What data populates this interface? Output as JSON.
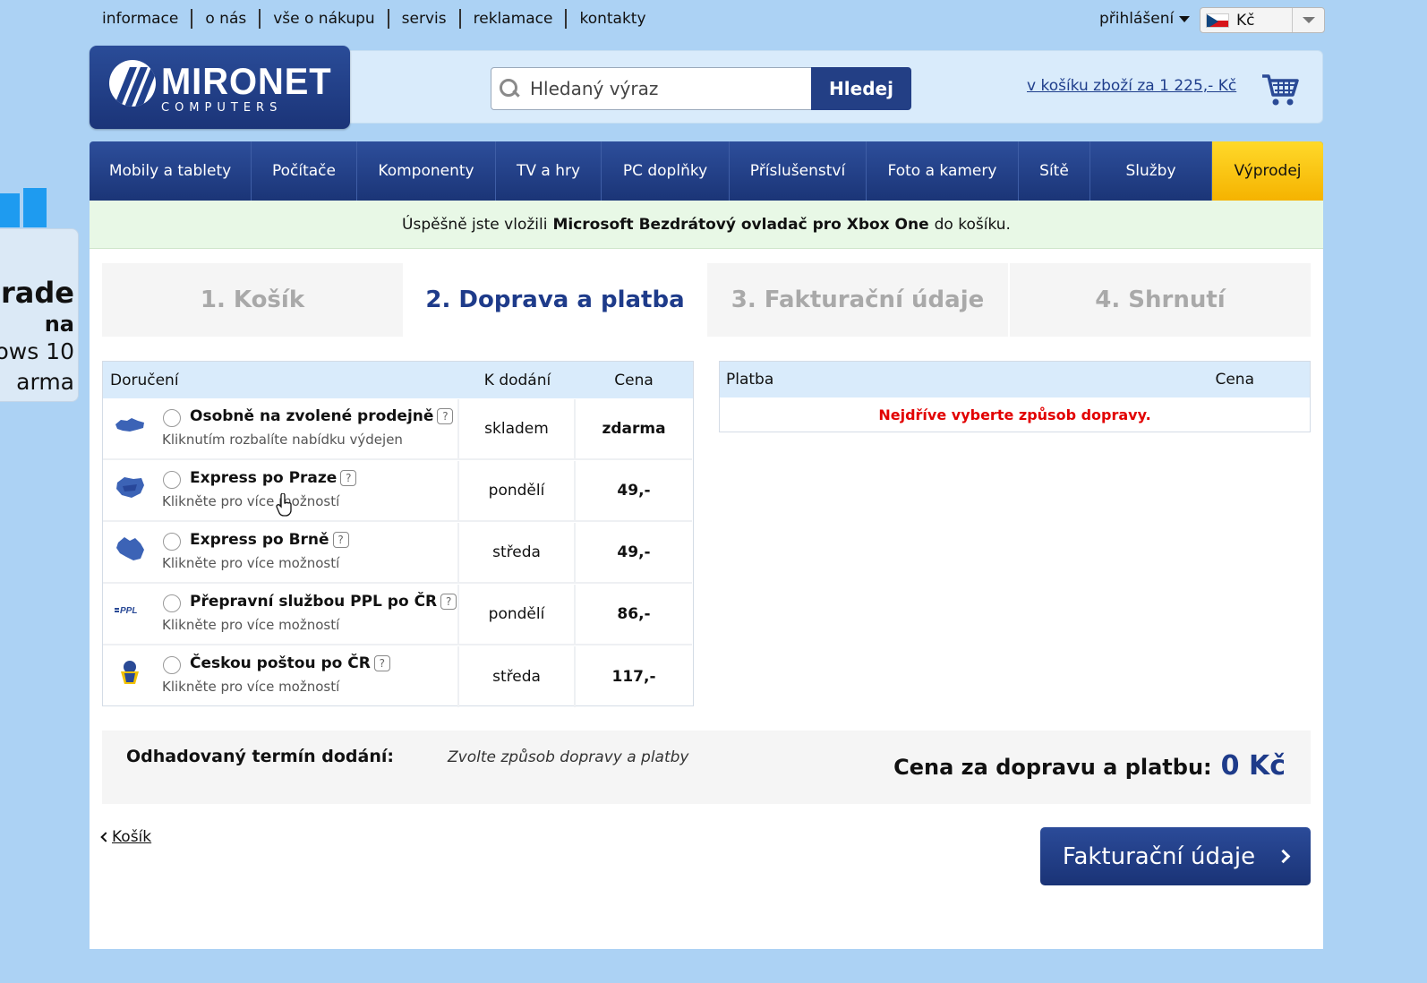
{
  "toplinks": [
    "informace",
    "o nás",
    "vše o nákupu",
    "servis",
    "reklamace",
    "kontakty"
  ],
  "login": "přihlášení",
  "currency": "Kč",
  "logo": {
    "brand": "MIRONET",
    "sub": "COMPUTERS"
  },
  "search": {
    "placeholder": "Hledaný výraz",
    "button": "Hledej"
  },
  "cart": {
    "link": "v košíku zboží za 1 225,- Kč"
  },
  "nav": [
    {
      "label": "Mobily a tablety",
      "w": 181
    },
    {
      "label": "Počítače",
      "w": 118
    },
    {
      "label": "Komponenty",
      "w": 155
    },
    {
      "label": "TV a hry",
      "w": 118
    },
    {
      "label": "PC doplňky",
      "w": 143
    },
    {
      "label": "Příslušenství",
      "w": 153
    },
    {
      "label": "Foto a kamery",
      "w": 170
    },
    {
      "label": "Sítě",
      "w": 80
    },
    {
      "label": "Služby",
      "w": 136
    }
  ],
  "nav_sale": "Výprodej",
  "notice": {
    "pre": "Úspěšně jste vložili",
    "product": "Microsoft Bezdrátový ovladač pro Xbox One",
    "post": "do košíku."
  },
  "steps": [
    "1. Košík",
    "2. Doprava a platba",
    "3. Fakturační údaje",
    "4. Shrnutí"
  ],
  "delivery": {
    "headers": {
      "name": "Doručení",
      "when": "K dodání",
      "price": "Cena"
    },
    "rows": [
      {
        "title": "Osobně na zvolené prodejně",
        "hint": "Kliknutím rozbalíte nabídku výdejen",
        "when": "skladem",
        "price": "zdarma",
        "icon": "czech-map-icon"
      },
      {
        "title": "Express po Praze",
        "hint": "Klikněte pro více možností",
        "when": "pondělí",
        "price": "49,-",
        "icon": "prague-map-icon"
      },
      {
        "title": "Express po Brně",
        "hint": "Klikněte pro více možností",
        "when": "středa",
        "price": "49,-",
        "icon": "brno-map-icon"
      },
      {
        "title": "Přepravní službou PPL po ČR",
        "hint": "Klikněte pro více možností",
        "when": "pondělí",
        "price": "86,-",
        "icon": "ppl-logo-icon"
      },
      {
        "title": "Českou poštou po ČR",
        "hint": "Klikněte pro více možností",
        "when": "středa",
        "price": "117,-",
        "icon": "ceska-posta-icon"
      }
    ]
  },
  "payment": {
    "headers": {
      "name": "Platba",
      "price": "Cena"
    },
    "message": "Nejdříve vyberte způsob dopravy."
  },
  "summary": {
    "estimate_label": "Odhadovaný termín dodání:",
    "estimate_value": "Zvolte způsob dopravy a platby",
    "total_label": "Cena za dopravu a platbu:",
    "total_value": "0 Kč"
  },
  "back_link": "Košík",
  "next_button": "Fakturační údaje",
  "promo": {
    "line1": "grade",
    "line2": "na",
    "line3": "ows 10",
    "line4": "arma"
  },
  "colors": {
    "brand": "#1e3b8a",
    "nav": "#23418a",
    "sale": "#ffcc00",
    "error": "#e20000",
    "background": "#acd2f4"
  }
}
